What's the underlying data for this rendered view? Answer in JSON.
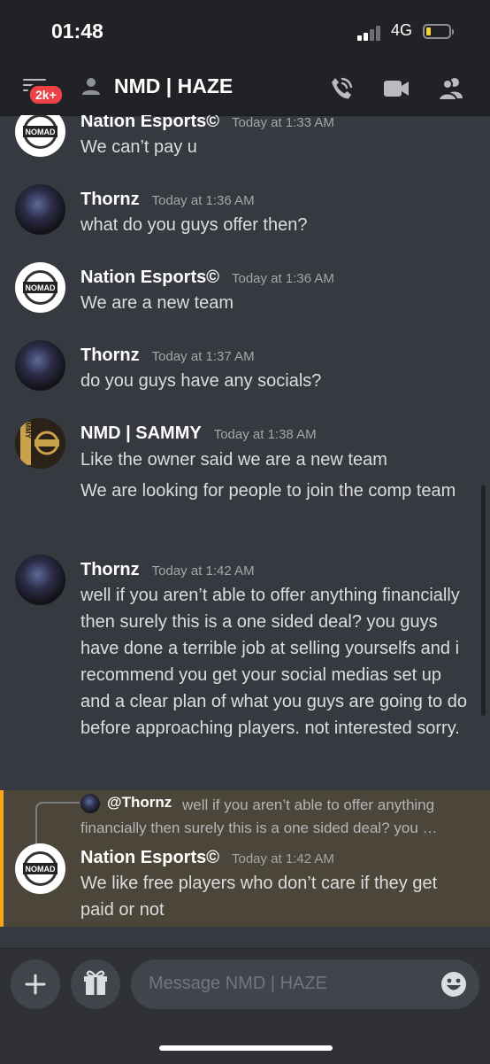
{
  "status_bar": {
    "time": "01:48",
    "network": "4G"
  },
  "header": {
    "badge": "2k+",
    "title": "NMD | HAZE"
  },
  "messages": [
    {
      "author": "Nation Esports©",
      "timestamp": "Today at 1:33 AM",
      "lines": [
        "We can’t pay u"
      ]
    },
    {
      "author": "Thornz",
      "timestamp": "Today at 1:36 AM",
      "lines": [
        "what do you guys offer then?"
      ]
    },
    {
      "author": "Nation Esports©",
      "timestamp": "Today at 1:36 AM",
      "lines": [
        "We are a new team"
      ]
    },
    {
      "author": "Thornz",
      "timestamp": "Today at 1:37 AM",
      "lines": [
        "do you guys have any socials?"
      ]
    },
    {
      "author": "NMD | SAMMY",
      "timestamp": "Today at 1:38 AM",
      "lines": [
        "Like the owner said we are a new team",
        "We are looking for people to join the comp team"
      ]
    },
    {
      "author": "Thornz",
      "timestamp": "Today at 1:42 AM",
      "lines": [
        "well if you aren’t able to offer anything financially then surely this is a one sided deal? you guys have done a terrible job at selling yourselfs and i recommend you get your social medias set up and a clear plan of what you guys are going to do before approaching players. not interested sorry."
      ]
    },
    {
      "author": "Nation Esports©",
      "timestamp": "Today at 1:42 AM",
      "lines": [
        "We like free players who don’t care if they get paid or not"
      ]
    }
  ],
  "reply": {
    "mention": "@Thornz",
    "text": "well if you aren’t able to offer anything financially then surely this is a one sided deal? you …"
  },
  "avatars": {
    "nomad_text": "NOMAD",
    "sammy_text": "SAMMY"
  },
  "composer": {
    "placeholder": "Message NMD | HAZE"
  },
  "colors": {
    "accent": "#faa61a",
    "badge": "#ed4245",
    "background": "#36393f"
  }
}
